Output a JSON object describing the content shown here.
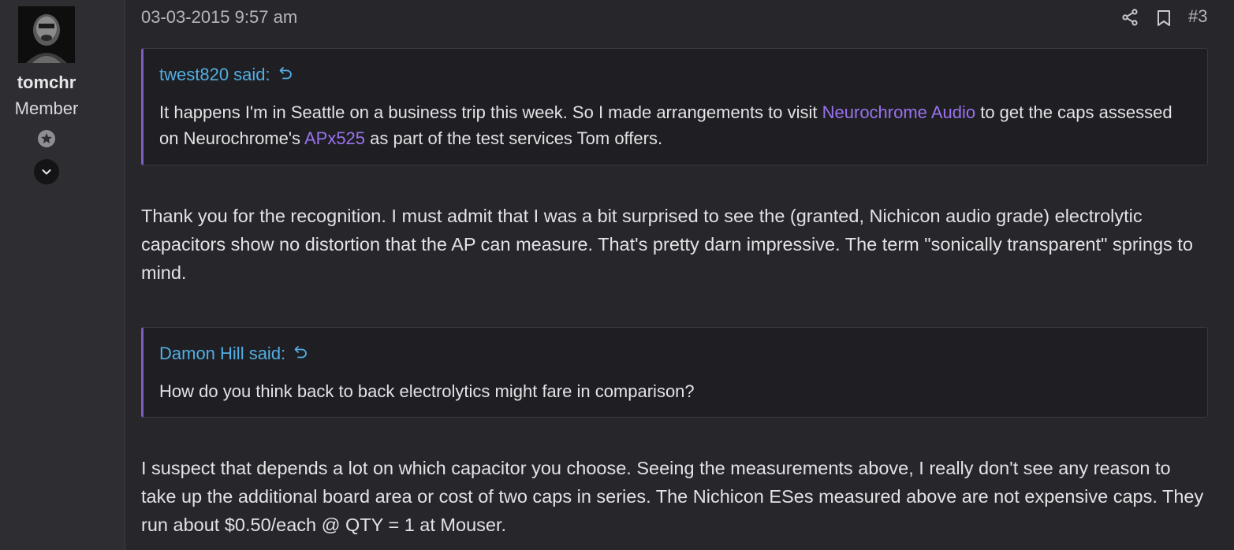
{
  "user": {
    "name": "tomchr",
    "title": "Member"
  },
  "post": {
    "date": "03-03-2015 9:57 am",
    "number": "#3"
  },
  "quote1": {
    "author": "twest820 said:",
    "text_before": "It happens I'm in Seattle on a business trip this week. So I made arrangements to visit ",
    "link1": "Neurochrome Audio",
    "text_middle": " to get the caps assessed on Neurochrome's ",
    "link2": "APx525",
    "text_after": " as part of the test services Tom offers."
  },
  "paragraph1": "Thank you for the recognition. I must admit that I was a bit surprised to see the (granted, Nichicon audio grade) electrolytic capacitors show no distortion that the AP can measure. That's pretty darn impressive. The term \"sonically transparent\" springs to mind.",
  "quote2": {
    "author": "Damon Hill said:",
    "text": "How do you think back to back electrolytics might fare in comparison?"
  },
  "paragraph2": "I suspect that depends a lot on which capacitor you choose. Seeing the measurements above, I really don't see any reason to take up the additional board area or cost of two caps in series. The Nichicon ESes measured above are not expensive caps. They run about $0.50/each @ QTY = 1 at Mouser.",
  "icons": {
    "avatar": "avatar-photo",
    "star": "star-circle-icon",
    "expand": "chevron-down-icon",
    "share": "share-icon",
    "bookmark": "bookmark-icon",
    "quote_jump": "jump-arrow-icon"
  },
  "colors": {
    "background": "#26262b",
    "sidebar": "#2d2d32",
    "quote_bg": "#1f1f23",
    "quote_border": "#7a5fc0",
    "author_link": "#52aee3",
    "content_link": "#9a72ee",
    "text": "#e2e3e5",
    "muted": "#b5b6ba"
  }
}
